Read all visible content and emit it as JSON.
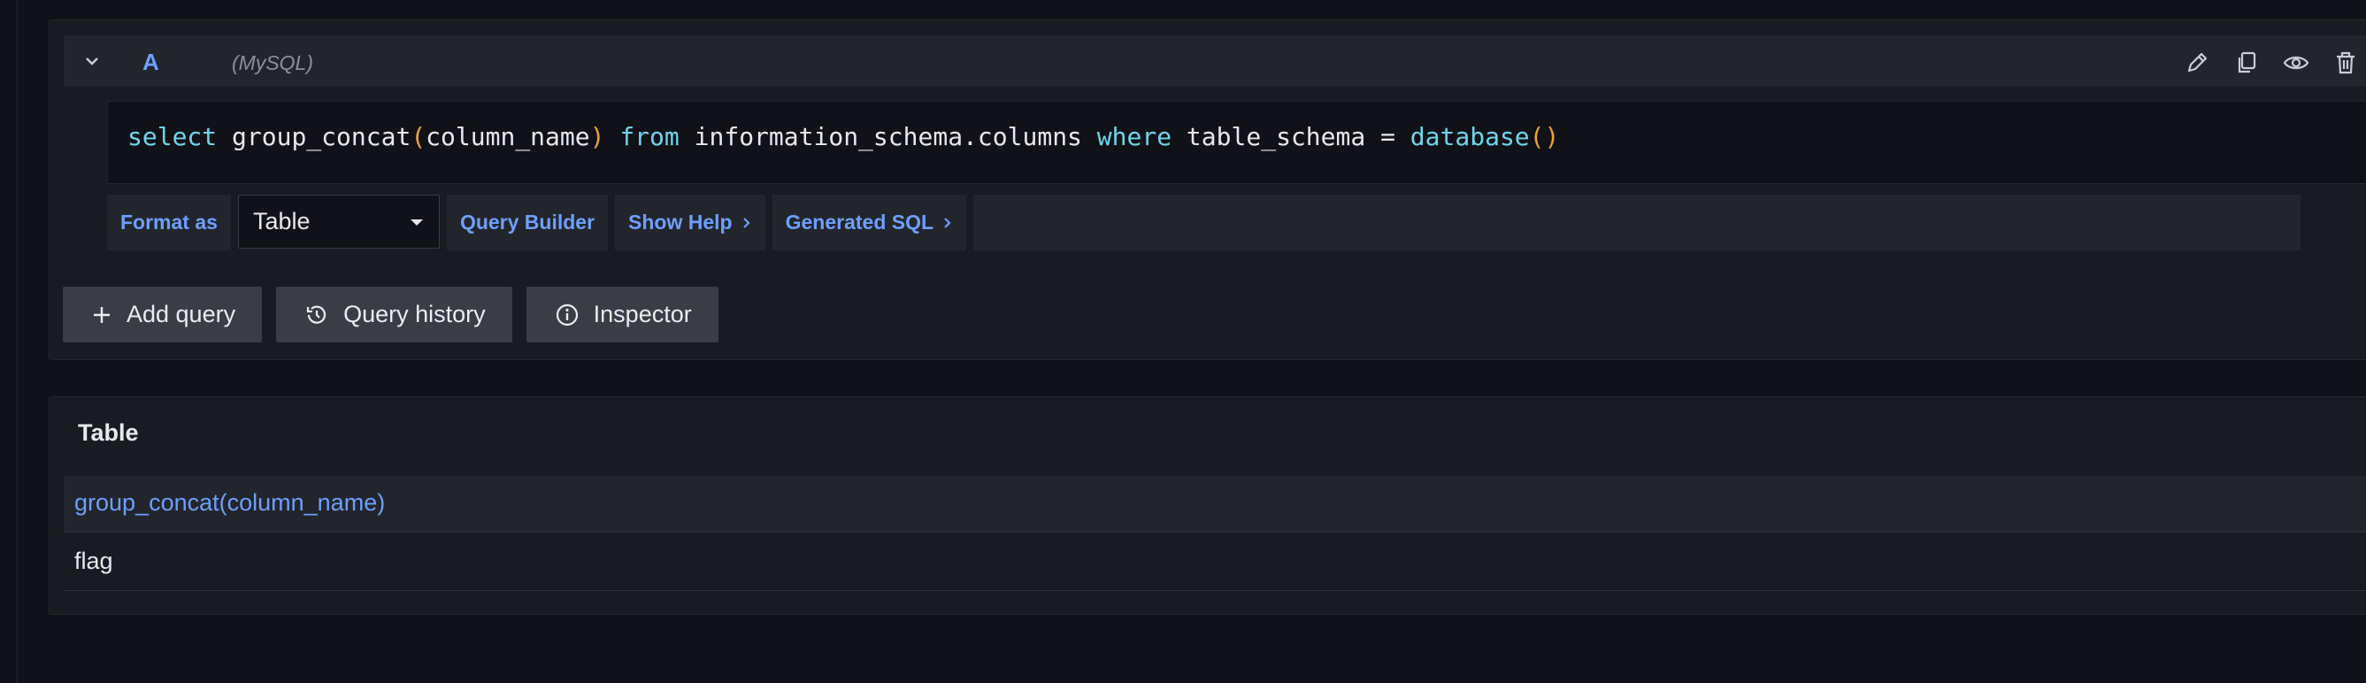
{
  "query": {
    "ref_id": "A",
    "datasource": "(MySQL)",
    "sql_tokens": [
      {
        "t": "select",
        "c": "kw"
      },
      {
        "t": " group_concat",
        "c": "fn"
      },
      {
        "t": "(",
        "c": "paren"
      },
      {
        "t": "column_name",
        "c": "id"
      },
      {
        "t": ")",
        "c": "paren"
      },
      {
        "t": " ",
        "c": "id"
      },
      {
        "t": "from",
        "c": "kw"
      },
      {
        "t": " information_schema.columns ",
        "c": "id"
      },
      {
        "t": "where",
        "c": "kw"
      },
      {
        "t": " table_schema = ",
        "c": "id"
      },
      {
        "t": "database",
        "c": "kw"
      },
      {
        "t": "(",
        "c": "paren"
      },
      {
        "t": ")",
        "c": "paren"
      }
    ]
  },
  "toolbar": {
    "format_as_label": "Format as",
    "format_value": "Table",
    "query_builder_label": "Query Builder",
    "show_help_label": "Show Help",
    "generated_sql_label": "Generated SQL"
  },
  "actions": {
    "add_query_label": "Add query",
    "query_history_label": "Query history",
    "inspector_label": "Inspector"
  },
  "results": {
    "title": "Table",
    "column_header": "group_concat(column_name)",
    "rows": [
      "flag"
    ]
  },
  "colors": {
    "accent": "#6e9fff",
    "keyword": "#6fd5ec",
    "paren": "#e8a23f",
    "background": "#111217",
    "panel": "#181b1f"
  }
}
